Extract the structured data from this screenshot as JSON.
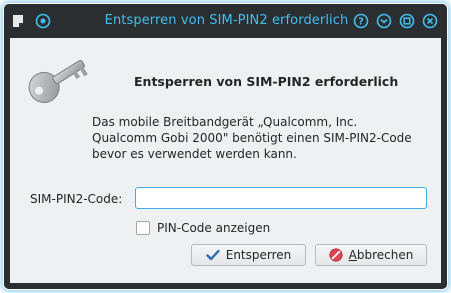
{
  "window": {
    "title": "Entsperren von SIM-PIN2 erforderlich",
    "accent_color": "#3fc0f0",
    "titlebar_bg": "#2b2e31"
  },
  "titlebar": {
    "left_icons": [
      "document-icon",
      "menu-circle-icon"
    ],
    "right_buttons": [
      "help-icon",
      "minimize-icon",
      "maximize-icon",
      "close-icon"
    ]
  },
  "dialog": {
    "heading": "Entsperren von SIM-PIN2 erforderlich",
    "description": [
      "Das mobile Breitbandgerät „Qualcomm, Inc.",
      "Qualcomm Gobi 2000\" benötigt einen SIM-PIN2-Code",
      "bevor es verwendet werden kann."
    ],
    "pin_label": "SIM-PIN2-Code:",
    "pin_value": "",
    "show_pin_label": "PIN-Code anzeigen",
    "show_pin_checked": false,
    "unlock_button": "Entsperren",
    "cancel_button_underline": "A",
    "cancel_button_rest": "bbrechen"
  }
}
